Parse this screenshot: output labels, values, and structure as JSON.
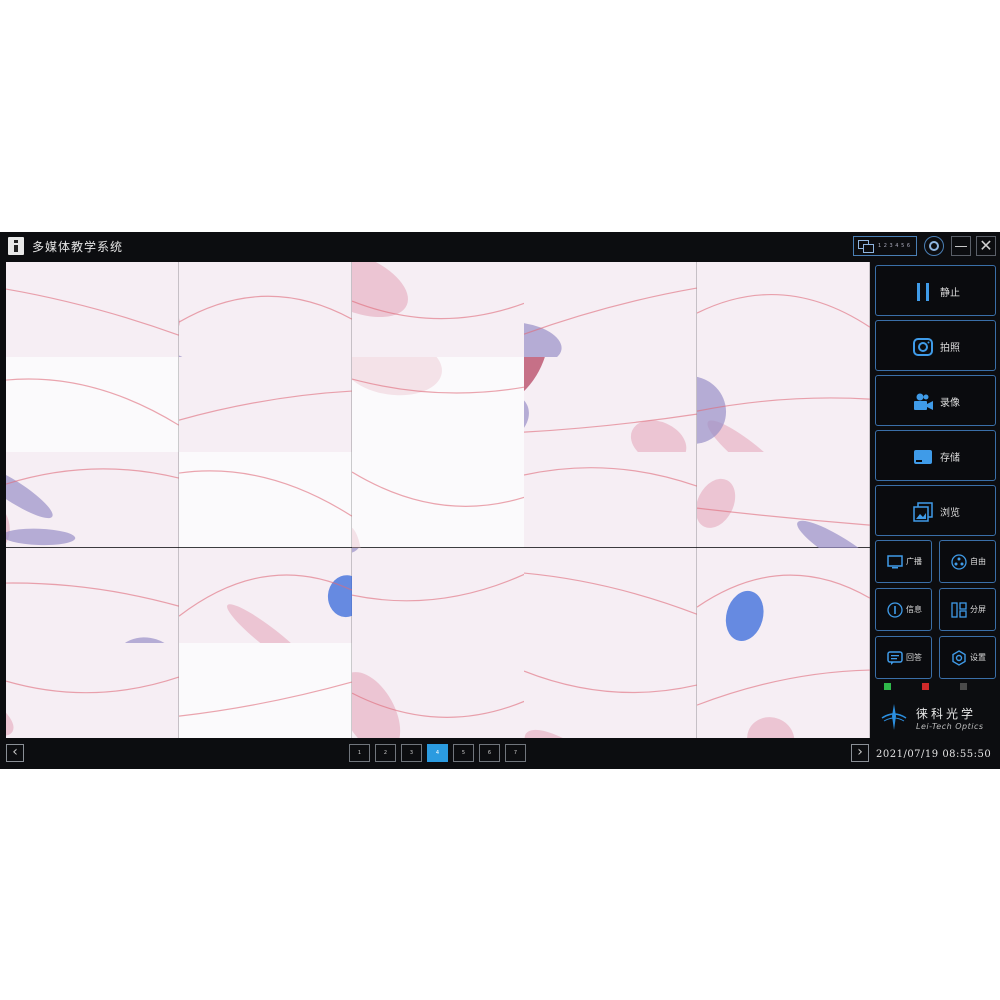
{
  "window": {
    "title": "多媒体教学系统",
    "screens_label": "1 2 3 4 5 6",
    "minimize_icon": "minimize-icon",
    "close_glyph": "✕"
  },
  "colors": {
    "background": "#0c0d10",
    "button_border": "#3a6fa8",
    "active_page": "#2b9be0",
    "tissue_pink": "#e8b4c4",
    "tissue_purple": "#9a90c8",
    "tissue_red": "#b23a58",
    "stain_blue": "#2a5fd8"
  },
  "image_grid": {
    "rows": 5,
    "cols": 5,
    "description_hidden": true
  },
  "controls": {
    "big_buttons": [
      {
        "icon": "pause-icon",
        "label": "静止"
      },
      {
        "icon": "camera-icon",
        "label": "拍照"
      },
      {
        "icon": "video-camera-icon",
        "label": "录像"
      },
      {
        "icon": "storage-icon",
        "label": "存储"
      },
      {
        "icon": "gallery-icon",
        "label": "浏览"
      }
    ],
    "small_buttons": [
      {
        "icon": "monitor-icon",
        "label": "广播"
      },
      {
        "icon": "network-icon",
        "label": "自由"
      },
      {
        "icon": "info-icon",
        "label": "信息"
      },
      {
        "icon": "split-icon",
        "label": "分屏"
      },
      {
        "icon": "message-icon",
        "label": "回答"
      },
      {
        "icon": "settings-icon",
        "label": "设置"
      }
    ],
    "status_dots": [
      "#2fb84a",
      "#d02a2a",
      "#4a4a4a"
    ]
  },
  "logo": {
    "cn": "徕科光学",
    "en": "Lei-Tech Optics"
  },
  "pagination": {
    "prev": "‹",
    "next": "›",
    "pages": [
      "1",
      "2",
      "3",
      "4",
      "5",
      "6",
      "7"
    ],
    "active_index": 3
  },
  "datetime": "2021/07/19 08:55:50"
}
